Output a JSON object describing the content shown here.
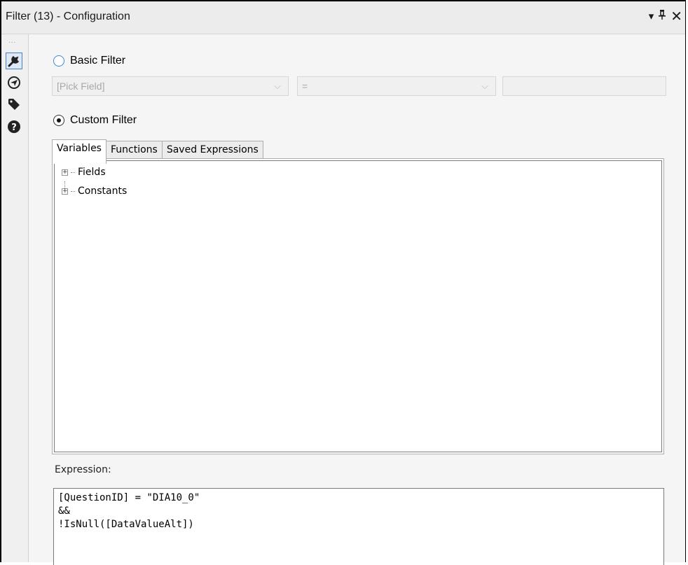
{
  "window": {
    "title": "Filter (13) - Configuration",
    "controls": {
      "dropdown": "▾",
      "pin": "⊥",
      "close": "✕"
    }
  },
  "sidebar": {
    "grip": "...",
    "icons": [
      "wrench-icon",
      "navigation-icon",
      "tag-icon",
      "help-icon"
    ]
  },
  "basic_filter": {
    "label": "Basic Filter",
    "selected": false,
    "field_select": "[Pick Field]",
    "operator_select": "=",
    "value_input": ""
  },
  "custom_filter": {
    "label": "Custom Filter",
    "selected": true
  },
  "tabs": [
    {
      "label": "Variables",
      "active": true
    },
    {
      "label": "Functions",
      "active": false
    },
    {
      "label": "Saved Expressions",
      "active": false
    }
  ],
  "tree": [
    {
      "label": "Fields",
      "expander": "+"
    },
    {
      "label": "Constants",
      "expander": "+"
    }
  ],
  "expression": {
    "label": "Expression:",
    "text": "[QuestionID] = \"DIA10_0\"\n&&\n!IsNull([DataValueAlt])"
  },
  "colors": {
    "radio_unchecked_border": "#3a8ad6",
    "active_sidebar_border": "#4a7fc1"
  }
}
